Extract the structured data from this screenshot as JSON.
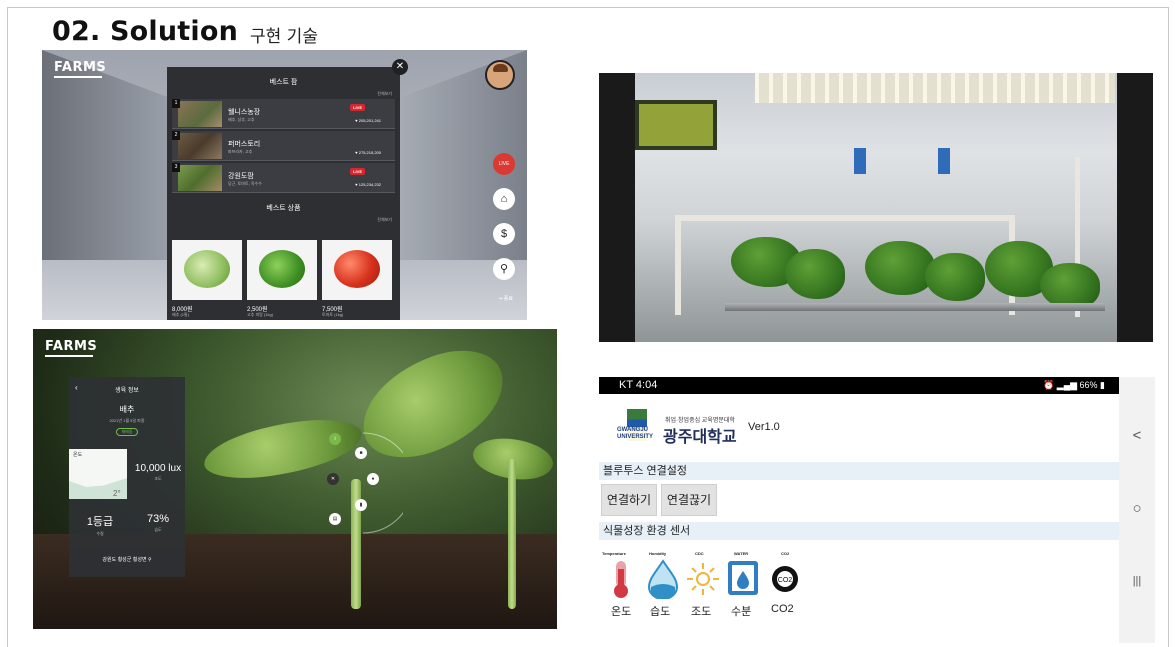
{
  "slide": {
    "title": "02. Solution",
    "subtitle": "구현 기술"
  },
  "vr_market": {
    "logo": "FARMS",
    "best_farms_title": "베스트 팜",
    "best_products_title": "베스트 상품",
    "more_label": "전체보기",
    "live_badge": "LIVE",
    "farms": [
      {
        "rank": "1",
        "name": "웰니스농장",
        "desc": "배추, 상추, 고추",
        "likes": "205,201,241",
        "live": true
      },
      {
        "rank": "2",
        "name": "퍼머스토리",
        "desc": "파프리카, 고추",
        "likes": "275,215,200",
        "live": false
      },
      {
        "rank": "3",
        "name": "강원도팜",
        "desc": "당근, 토마토, 옥수수",
        "likes": "125,234,232",
        "live": true
      }
    ],
    "products": [
      {
        "price": "8,000원",
        "desc": "배추 (1통)"
      },
      {
        "price": "2,500원",
        "desc": "고추 피망 (1kg)"
      },
      {
        "price": "7,500원",
        "desc": "토마토 (1kg)"
      }
    ],
    "live_button_label": "LIVE",
    "exit_label": "종료"
  },
  "plant_info": {
    "logo": "FARMS",
    "header": "생육 정보",
    "crop": "배추",
    "date": "2021년 1월 5일 파종",
    "tag": "재배중",
    "graph_label": "온도",
    "graph_value": "2°",
    "lux_value": "10,000 lux",
    "lux_label": "조도",
    "grade_value": "1등급",
    "grade_label": "수질",
    "humidity_value": "73%",
    "humidity_label": "습도",
    "location": "강원도 횡성군 횡성면"
  },
  "phone_app": {
    "status_time": "KT 4:04",
    "status_right": "66%",
    "uni_small": "취업·창업중심 교육명문대학",
    "uni_en": "GWANGJU UNIVERSITY",
    "uni_name": "광주대학교",
    "version": "Ver1.0",
    "bluetooth_section": "블루투스 연결설정",
    "connect_button": "연결하기",
    "disconnect_button": "연결끊기",
    "sensor_section": "식물성장 환경 센서",
    "sensors": [
      {
        "head": "Temperature",
        "label": "온도"
      },
      {
        "head": "Humidity",
        "label": "습도"
      },
      {
        "head": "CDC",
        "label": "조도"
      },
      {
        "head": "WATER",
        "label": "수분"
      },
      {
        "head": "CO2",
        "label": "CO2"
      }
    ],
    "nav_back": "<",
    "nav_home": "○",
    "nav_recent": "|||"
  },
  "colors": {
    "live_red": "#d7262d",
    "panel_dark": "#2d2f33",
    "section_bar": "#e7f0f7"
  }
}
